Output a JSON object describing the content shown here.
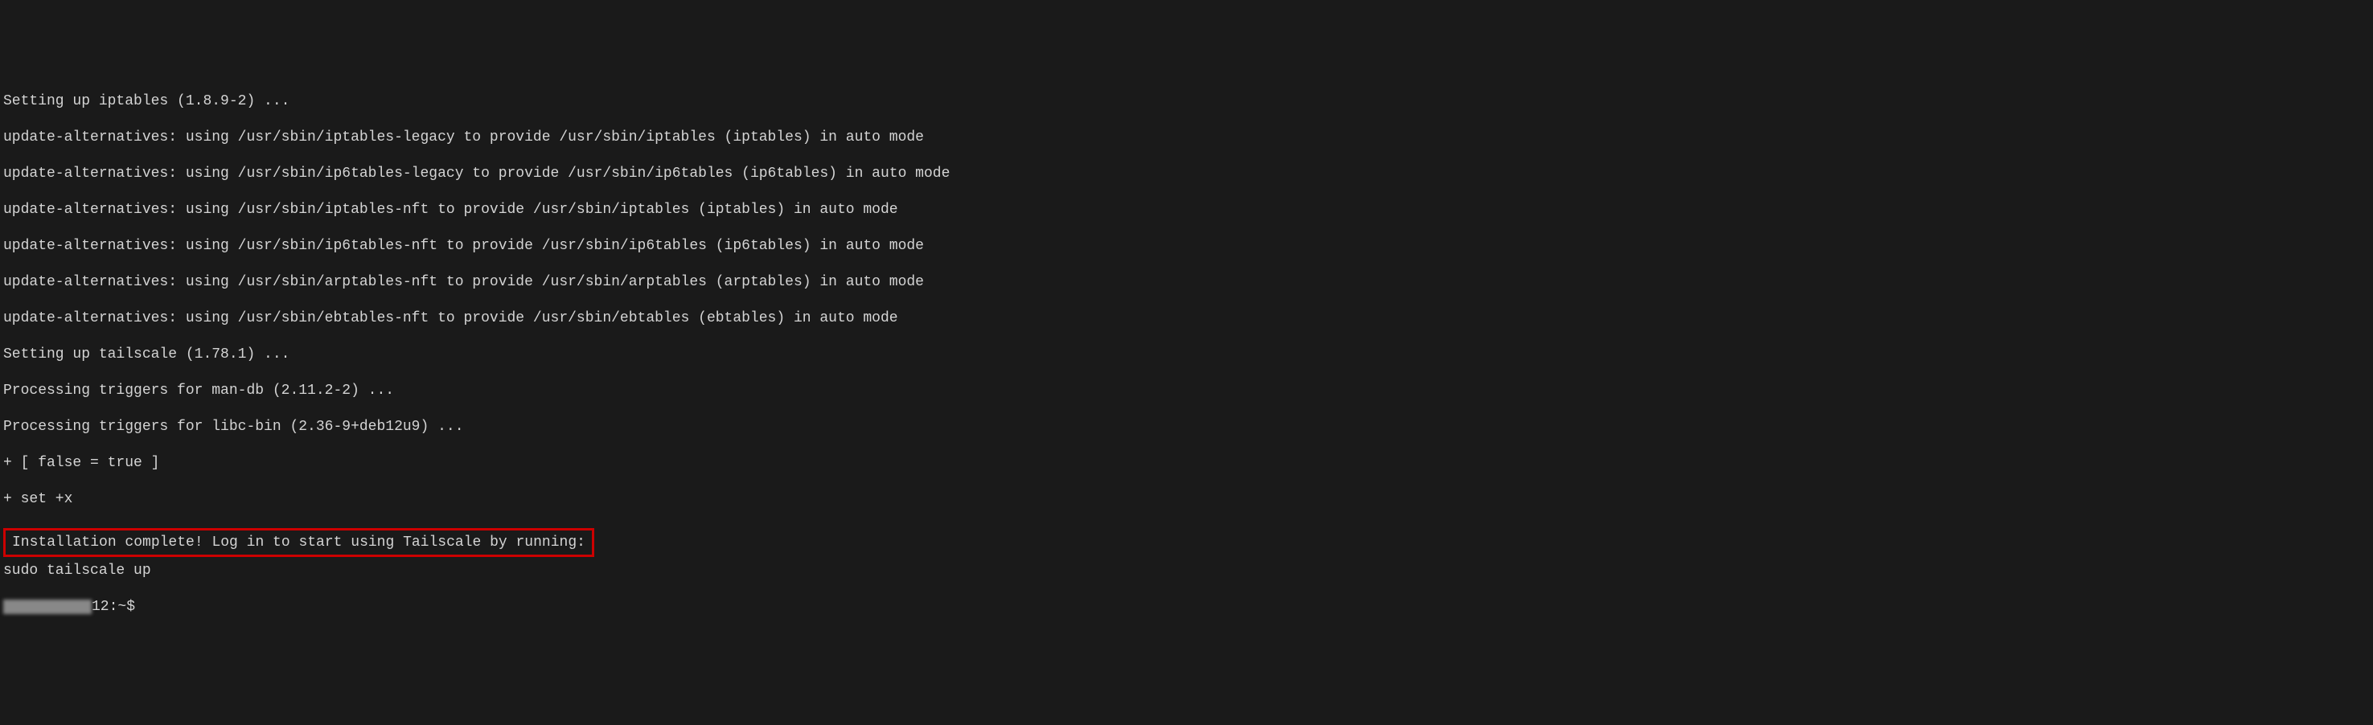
{
  "terminal": {
    "lines": [
      "Setting up iptables (1.8.9-2) ...",
      "update-alternatives: using /usr/sbin/iptables-legacy to provide /usr/sbin/iptables (iptables) in auto mode",
      "update-alternatives: using /usr/sbin/ip6tables-legacy to provide /usr/sbin/ip6tables (ip6tables) in auto mode",
      "update-alternatives: using /usr/sbin/iptables-nft to provide /usr/sbin/iptables (iptables) in auto mode",
      "update-alternatives: using /usr/sbin/ip6tables-nft to provide /usr/sbin/ip6tables (ip6tables) in auto mode",
      "update-alternatives: using /usr/sbin/arptables-nft to provide /usr/sbin/arptables (arptables) in auto mode",
      "update-alternatives: using /usr/sbin/ebtables-nft to provide /usr/sbin/ebtables (ebtables) in auto mode",
      "Setting up tailscale (1.78.1) ...",
      "Processing triggers for man-db (2.11.2-2) ...",
      "Processing triggers for libc-bin (2.36-9+deb12u9) ...",
      "+ [ false = true ]",
      "+ set +x"
    ],
    "highlighted": "Installation complete! Log in to start using Tailscale by running:",
    "command": "sudo tailscale up",
    "prompt_suffix": "12:~$"
  }
}
